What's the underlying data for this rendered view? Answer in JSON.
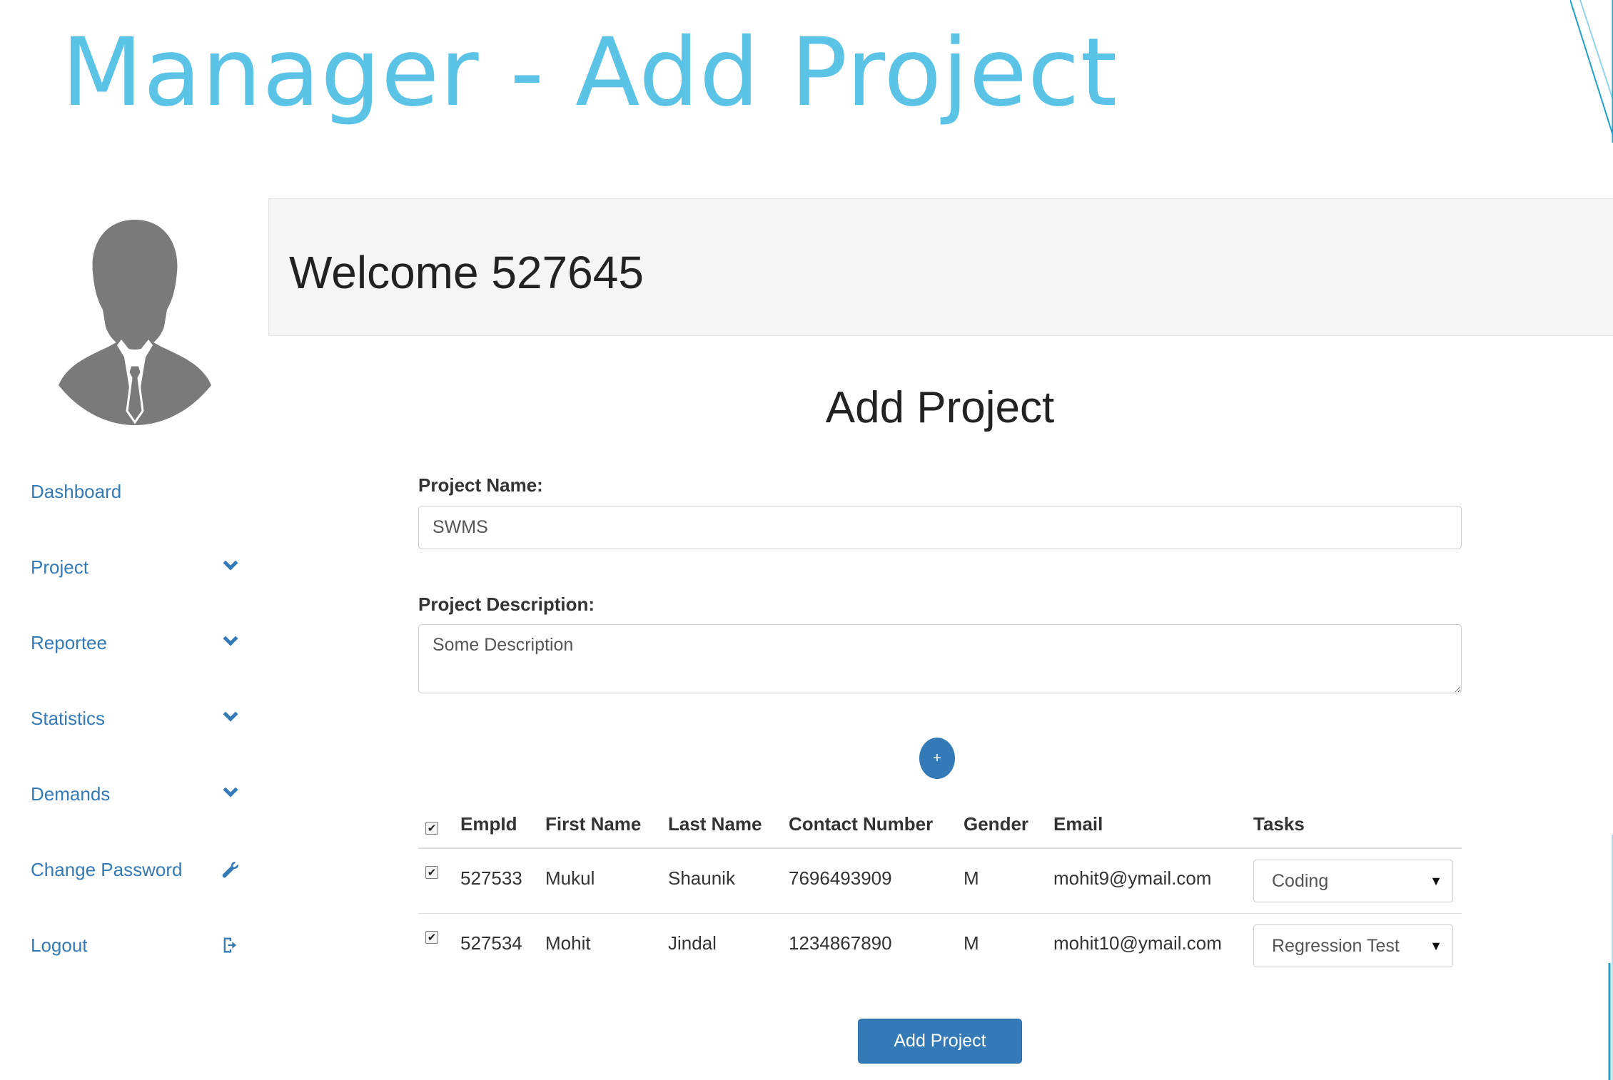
{
  "slide": {
    "title": "Manager - Add Project"
  },
  "sidebar": {
    "items": [
      {
        "label": "Dashboard",
        "icon": ""
      },
      {
        "label": "Project",
        "icon": "chevron-down-icon"
      },
      {
        "label": "Reportee",
        "icon": "chevron-down-icon"
      },
      {
        "label": "Statistics",
        "icon": "chevron-down-icon"
      },
      {
        "label": "Demands",
        "icon": "chevron-down-icon"
      },
      {
        "label": "Change Password",
        "icon": "wrench-icon"
      },
      {
        "label": "Logout",
        "icon": "logout-icon"
      }
    ]
  },
  "header": {
    "welcome": "Welcome 527645"
  },
  "form": {
    "heading": "Add Project",
    "project_name_label": "Project Name:",
    "project_name_value": "SWMS",
    "project_description_label": "Project Description:",
    "project_description_value": "Some Description",
    "add_row_label": "+",
    "submit_label": "Add Project"
  },
  "table": {
    "headers": [
      "EmpId",
      "First Name",
      "Last Name",
      "Contact Number",
      "Gender",
      "Email",
      "Tasks"
    ],
    "header_checked": true,
    "rows": [
      {
        "checked": true,
        "emp_id": "527533",
        "first_name": "Mukul",
        "last_name": "Shaunik",
        "contact": "7696493909",
        "gender": "M",
        "email": "mohit9@ymail.com",
        "task": "Coding"
      },
      {
        "checked": true,
        "emp_id": "527534",
        "first_name": "Mohit",
        "last_name": "Jindal",
        "contact": "1234867890",
        "gender": "M",
        "email": "mohit10@ymail.com",
        "task": "Regression Test"
      }
    ]
  },
  "colors": {
    "title": "#5bc3e6",
    "link": "#337ab7",
    "primary_button": "#337ab7",
    "jumbotron": "#f5f5f5"
  }
}
